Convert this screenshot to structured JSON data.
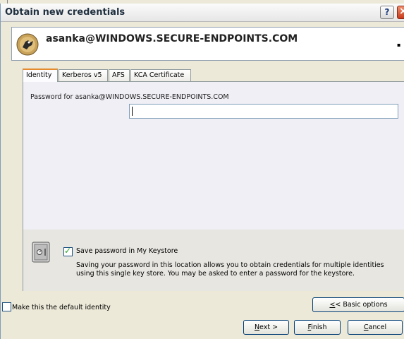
{
  "window": {
    "title": "Obtain new credentials",
    "help_glyph": "?"
  },
  "identity": {
    "name": "asanka@WINDOWS.SECURE-ENDPOINTS.COM",
    "expand_glyph": "▪"
  },
  "tabs": [
    {
      "label": "Identity",
      "active": true
    },
    {
      "label": "Kerberos v5",
      "active": false
    },
    {
      "label": "AFS",
      "active": false
    },
    {
      "label": "KCA Certificate",
      "active": false
    }
  ],
  "identity_panel": {
    "password_label": "Password for asanka@WINDOWS.SECURE-ENDPOINTS.COM",
    "password_value": "",
    "save_checkbox_label": "Save password in My Keystore",
    "save_checkbox_checked": true,
    "save_description": "Saving your password in this location allows you to obtain credentials for multiple identities using this single key store.  You may be asked to enter a password for the keystore."
  },
  "footer": {
    "default_identity_label": "Make this the default identity",
    "default_identity_checked": false,
    "basic_options": {
      "prefix": "",
      "mnemonic": "<",
      "rest": "< Basic options"
    },
    "next": {
      "prefix": "",
      "mnemonic": "N",
      "rest": "ext >"
    },
    "finish": {
      "prefix": "",
      "mnemonic": "F",
      "rest": "inish"
    },
    "cancel": {
      "prefix": "",
      "mnemonic": "C",
      "rest": "ancel"
    }
  },
  "colors": {
    "tab_accent": "#e68b2c",
    "check_mark": "#21a121",
    "close_button": "#c83a1a"
  }
}
